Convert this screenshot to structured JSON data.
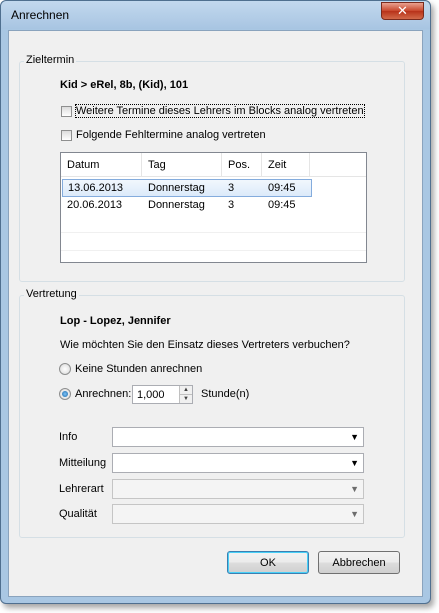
{
  "window": {
    "title": "Anrechnen",
    "close_glyph": "✕"
  },
  "zieltermin": {
    "group_label": "Zieltermin",
    "lesson": "Kid > eRel, 8b, (Kid), 101",
    "option_block": "Weitere Termine dieses Lehrers im Blocks analog vertreten",
    "option_absences": "Folgende Fehltermine analog vertreten",
    "table": {
      "headers": [
        "Datum",
        "Tag",
        "Pos.",
        "Zeit"
      ],
      "rows": [
        [
          "13.06.2013",
          "Donnerstag",
          "3",
          "09:45"
        ],
        [
          "20.06.2013",
          "Donnerstag",
          "3",
          "09:45"
        ]
      ]
    }
  },
  "vertretung": {
    "group_label": "Vertretung",
    "teacher": "Lop - Lopez, Jennifer",
    "question": "Wie möchten Sie den Einsatz dieses Vertreters verbuchen?",
    "radio_none": "Keine Stunden anrechnen",
    "radio_credit": "Anrechnen:",
    "credit_value": "1,000",
    "credit_unit": "Stunde(n)",
    "fields": {
      "info": "Info",
      "mitteilung": "Mitteilung",
      "lehrerart": "Lehrerart",
      "qualitaet": "Qualität"
    }
  },
  "buttons": {
    "ok": "OK",
    "cancel": "Abbrechen"
  }
}
